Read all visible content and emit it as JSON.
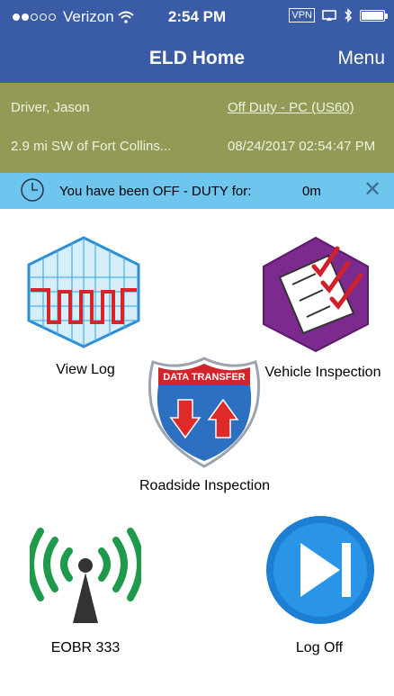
{
  "status_bar": {
    "carrier": "Verizon",
    "time": "2:54 PM",
    "vpn": "VPN"
  },
  "nav": {
    "title": "ELD Home",
    "menu_label": "Menu"
  },
  "driver_info": {
    "driver": "Driver, Jason",
    "duty_status": "Off Duty - PC (US60)",
    "location": "2.9 mi SW of Fort Collins...",
    "timestamp": "08/24/2017 02:54:47 PM"
  },
  "duty_bar": {
    "message": "You have been OFF - DUTY for:",
    "duration": "0m",
    "close_symbol": "✕"
  },
  "tiles": {
    "view_log": "View Log",
    "vehicle_inspection": "Vehicle Inspection",
    "roadside_inspection": "Roadside Inspection",
    "roadside_banner": "DATA TRANSFER",
    "eobr": "EOBR 333",
    "log_off": "Log Off"
  },
  "icons": {
    "view_log": "log-grid-icon",
    "vehicle_inspection": "checklist-icon",
    "roadside_inspection": "data-transfer-shield-icon",
    "eobr": "wireless-tower-icon",
    "log_off": "play-pause-icon"
  },
  "colors": {
    "nav_bg": "#3a5ba5",
    "info_bg": "#929a55",
    "duty_bg": "#6ec6ef"
  }
}
